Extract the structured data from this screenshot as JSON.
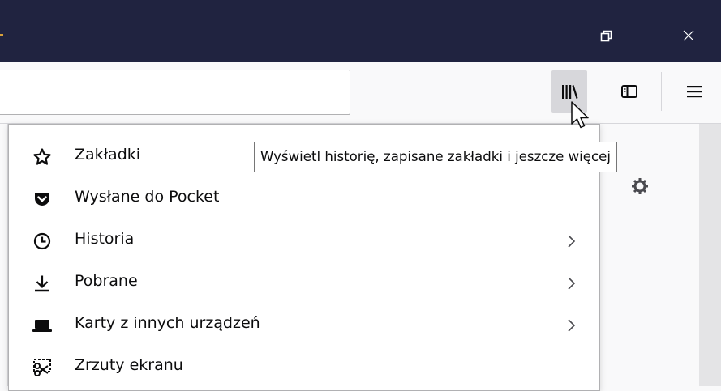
{
  "window": {
    "controls": [
      "minimize",
      "restore",
      "close"
    ]
  },
  "toolbar": {
    "library_button": "library-icon",
    "sidebar_button": "sidebar-icon",
    "menu_button": "hamburger-icon",
    "urlbar_value": ""
  },
  "library_menu": {
    "items": [
      {
        "label": "Zakładki",
        "icon": "star-icon",
        "has_submenu": false
      },
      {
        "label": "Wysłane do Pocket",
        "icon": "pocket-icon",
        "has_submenu": false
      },
      {
        "label": "Historia",
        "icon": "clock-icon",
        "has_submenu": true
      },
      {
        "label": "Pobrane",
        "icon": "download-icon",
        "has_submenu": true
      },
      {
        "label": "Karty z innych urządzeń",
        "icon": "synced-tabs-icon",
        "has_submenu": true
      },
      {
        "label": "Zrzuty ekranu",
        "icon": "screenshot-icon",
        "has_submenu": false
      }
    ]
  },
  "tooltip": {
    "text": "Wyświetl historię, zapisane zakładki i jeszcze więcej"
  },
  "colors": {
    "titlebar": "#202340",
    "toolbar": "#f9f9fa",
    "active_button": "#d7d7db",
    "menu_background": "#ffffff"
  }
}
